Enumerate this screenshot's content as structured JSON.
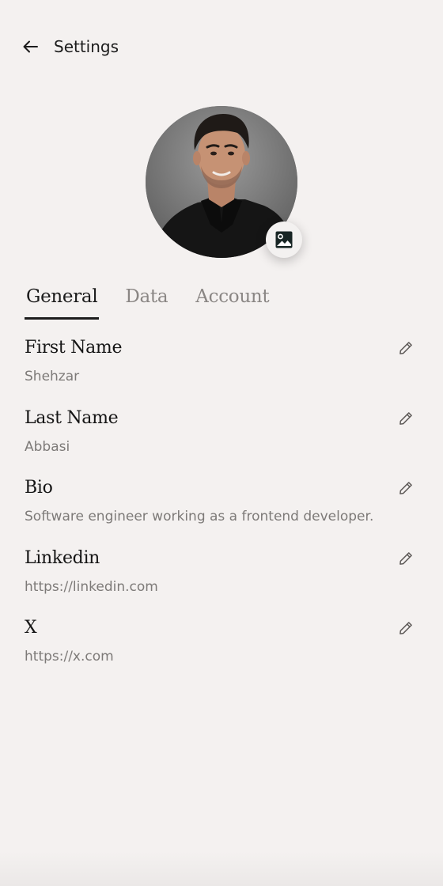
{
  "header": {
    "title": "Settings"
  },
  "profile": {
    "avatar_alt": "Profile photo of a man in a black shirt"
  },
  "tabs": [
    {
      "label": "General",
      "active": true
    },
    {
      "label": "Data",
      "active": false
    },
    {
      "label": "Account",
      "active": false
    }
  ],
  "fields": [
    {
      "label": "First Name",
      "value": "Shehzar"
    },
    {
      "label": "Last Name",
      "value": "Abbasi"
    },
    {
      "label": "Bio",
      "value": "Software engineer working as a frontend developer."
    },
    {
      "label": "Linkedin",
      "value": "https://linkedin.com"
    },
    {
      "label": "X",
      "value": "https://x.com"
    }
  ],
  "icons": {
    "back": "arrow-left-icon",
    "change_photo": "image-icon",
    "edit": "pencil-icon"
  },
  "colors": {
    "background": "#f4f1f0",
    "text_primary": "#151515",
    "text_secondary": "#7d7a78",
    "tab_inactive": "#8a8684"
  }
}
